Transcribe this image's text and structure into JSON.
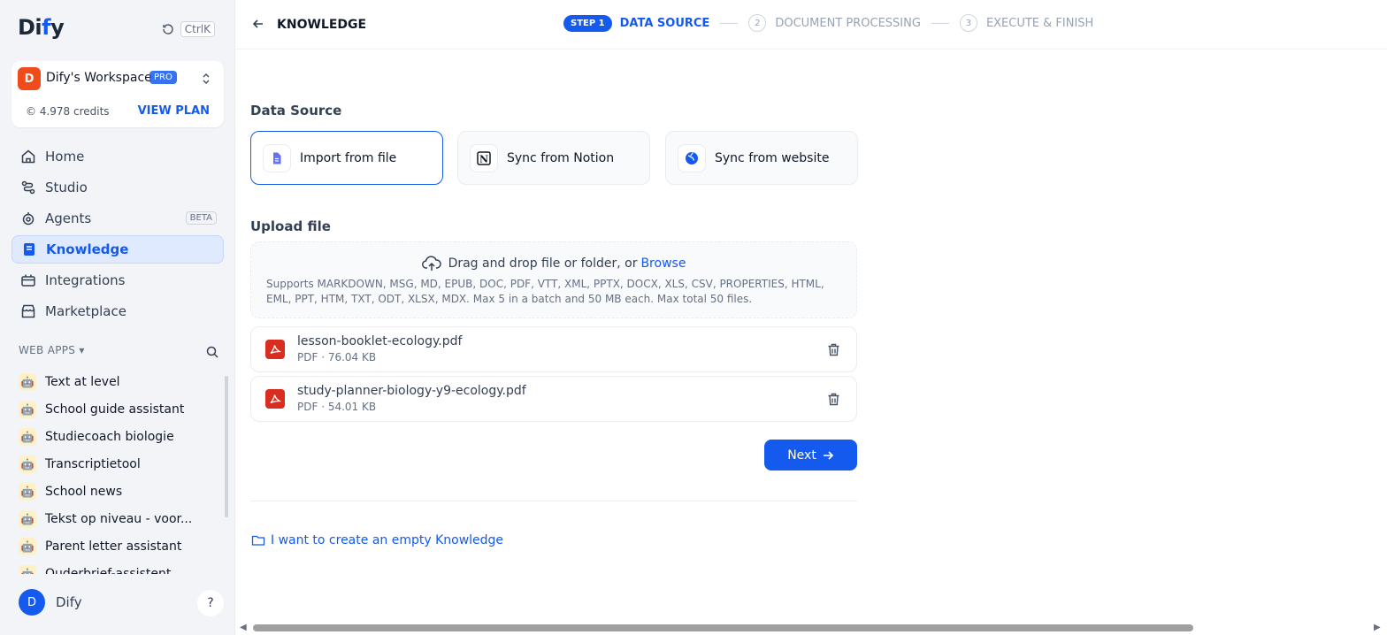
{
  "brand": {
    "logo_text_pre": "Di",
    "logo_text_i": "f",
    "logo_text_post": "y"
  },
  "shortcut": {
    "key_label": "CtrlK"
  },
  "workspace": {
    "avatar_letter": "D",
    "name": "Dify's Workspace",
    "plan_badge": "PRO",
    "credits": "4.978 credits",
    "view_plan": "VIEW PLAN"
  },
  "nav": {
    "items": [
      {
        "label": "Home",
        "icon": "home-icon"
      },
      {
        "label": "Studio",
        "icon": "studio-icon"
      },
      {
        "label": "Agents",
        "icon": "agents-icon",
        "badge": "BETA"
      },
      {
        "label": "Knowledge",
        "icon": "knowledge-icon",
        "active": true
      },
      {
        "label": "Integrations",
        "icon": "integrations-icon"
      },
      {
        "label": "Marketplace",
        "icon": "marketplace-icon"
      }
    ]
  },
  "web_apps": {
    "heading": "WEB APPS",
    "items": [
      "Text at level",
      "School guide assistant",
      "Studiecoach biologie",
      "Transcriptietool",
      "School news",
      "Tekst op niveau - voor...",
      "Parent letter assistant",
      "Ouderbrief-assistent"
    ]
  },
  "user": {
    "avatar_letter": "D",
    "name": "Dify",
    "help_label": "?"
  },
  "header": {
    "back_label": "",
    "title": "KNOWLEDGE",
    "steps": {
      "step1_badge": "STEP 1",
      "step1_label": "DATA SOURCE",
      "step2_num": "2",
      "step2_label": "DOCUMENT PROCESSING",
      "step3_num": "3",
      "step3_label": "EXECUTE & FINISH"
    }
  },
  "data_source": {
    "heading": "Data Source",
    "options": [
      {
        "label": "Import from file",
        "icon": "file-icon",
        "selected": true
      },
      {
        "label": "Sync from Notion",
        "icon": "notion-icon",
        "selected": false
      },
      {
        "label": "Sync from website",
        "icon": "globe-icon",
        "selected": false
      }
    ]
  },
  "upload": {
    "heading": "Upload file",
    "drop_text": "Drag and drop file or folder, or",
    "browse": "Browse",
    "supported": "Supports MARKDOWN, MSG, MD, EPUB, DOC, PDF, VTT, XML, PPTX, DOCX, XLS, CSV, PROPERTIES, HTML, EML, PPT, HTM, TXT, ODT, XLSX, MDX. Max 5 in a batch and 50 MB each. Max total 50 files."
  },
  "files": [
    {
      "name": "lesson-booklet-ecology.pdf",
      "meta": "PDF · 76.04 KB"
    },
    {
      "name": "study-planner-biology-y9-ecology.pdf",
      "meta": "PDF · 54.01 KB"
    }
  ],
  "actions": {
    "next": "Next",
    "empty_knowledge": "I want to create an empty Knowledge"
  },
  "colors": {
    "accent": "#155aef",
    "workspace_avatar": "#f04b1a",
    "pdf": "#d92d20"
  }
}
